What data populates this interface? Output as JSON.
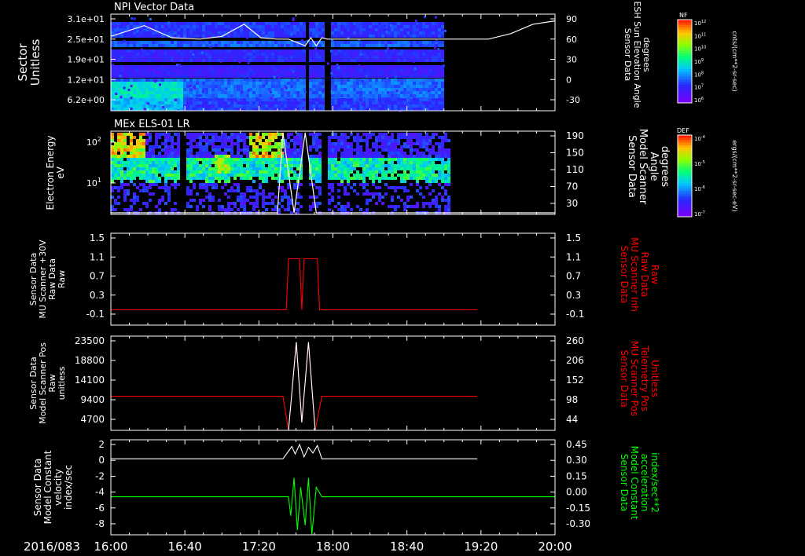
{
  "date_label": "2016/083",
  "time_ticks": [
    "16:00",
    "16:40",
    "17:20",
    "18:00",
    "18:40",
    "19:20",
    "20:00"
  ],
  "colors": {
    "background": "#000000",
    "axis": "#ffffff",
    "red_trace": "#ff0000",
    "green_trace": "#00ff00",
    "white_trace": "#ffffff"
  },
  "chart_data": [
    {
      "type": "heatmap",
      "title": "NPI Vector Data",
      "ylabel_left": [
        "Sector",
        "Unitless"
      ],
      "left_ticks": [
        "3.1e+01",
        "2.5e+01",
        "1.9e+01",
        "1.2e+01",
        "6.2e+00"
      ],
      "ylabel_right": [
        "Sensor Data",
        "ESH Sun Elevation Angle",
        "degrees"
      ],
      "right_ticks": [
        "90",
        "60",
        "30",
        "0",
        "-30"
      ],
      "colorbar": {
        "label": "NF",
        "units": "cnts/(cm**2-sr-sec)",
        "ticks": [
          "10^12",
          "10^11",
          "10^10",
          "10^9",
          "10^8",
          "10^7",
          "10^6"
        ]
      },
      "overlay_line": {
        "x": [
          16.0,
          16.3,
          16.55,
          16.8,
          17.0,
          17.2,
          17.35,
          17.5,
          17.6,
          17.75,
          17.8,
          17.85,
          17.9,
          17.95,
          19.4,
          19.6,
          19.8,
          20.0
        ],
        "y": [
          64,
          80,
          62,
          60,
          64,
          82,
          62,
          60,
          60,
          50,
          62,
          50,
          62,
          60,
          60,
          68,
          82,
          87
        ]
      }
    },
    {
      "type": "heatmap",
      "title": "MEx ELS-01 LR",
      "ylabel_left": [
        "Electron Energy",
        "eV"
      ],
      "left_ticks": [
        "10^2",
        "10^1"
      ],
      "ylabel_right": [
        "Sensor Data",
        "Model Scanner",
        "Angle",
        "degrees"
      ],
      "right_ticks": [
        "190",
        "150",
        "110",
        "70",
        "30"
      ],
      "colorbar": {
        "label": "DEF",
        "units": "ergs/(cm**2-sr-sec-eV)",
        "ticks": [
          "10^-4",
          "10^-5",
          "10^-6",
          "10^-7"
        ]
      },
      "overlay_line": {
        "x": [
          16.0,
          17.5,
          17.55,
          17.65,
          17.75,
          17.85,
          17.95,
          20.0
        ],
        "y": [
          0,
          0,
          190,
          0,
          190,
          0,
          0,
          0
        ]
      }
    },
    {
      "type": "line",
      "ylabel_left": [
        "Sensor Data",
        "MU Scanner +30V",
        "Raw Data",
        "Raw"
      ],
      "left_ticks": [
        "1.5",
        "1.1",
        "0.7",
        "0.3",
        "-0.1"
      ],
      "ylabel_right": [
        "Sensor Data",
        "MU Scanner Inh",
        "Raw Data",
        "Raw"
      ],
      "right_ticks": [
        "1.5",
        "1.1",
        "0.7",
        "0.3",
        "-0.1"
      ],
      "ylim": [
        -0.3,
        1.5
      ],
      "series": [
        {
          "color": "#ff0000",
          "x": [
            16.0,
            17.58,
            17.6,
            17.7,
            17.72,
            17.74,
            17.76,
            17.86,
            17.88,
            19.3
          ],
          "y": [
            -0.0,
            -0.0,
            1.0,
            1.0,
            0.0,
            1.0,
            1.0,
            1.0,
            -0.0,
            -0.0
          ]
        }
      ]
    },
    {
      "type": "line",
      "ylabel_left": [
        "Sensor Data",
        "Model Scanner Pos",
        "Raw",
        "unitless"
      ],
      "left_ticks": [
        "23500",
        "18800",
        "14100",
        "9400",
        "4700"
      ],
      "ylabel_right": [
        "Sensor Data",
        "MU Scanner Pos",
        "Telemetry Pos",
        "Unitless"
      ],
      "right_ticks": [
        "260",
        "206",
        "152",
        "98",
        "44"
      ],
      "ylim": [
        0,
        23500
      ],
      "series": [
        {
          "color": "#ff0000",
          "x": [
            16.0,
            17.55,
            17.6,
            17.67,
            17.72,
            17.78,
            17.84,
            17.9,
            19.3
          ],
          "y": [
            8500,
            8500,
            0,
            22000,
            2000,
            22000,
            0,
            8500,
            8500
          ]
        },
        {
          "color": "#ffffff",
          "x": [
            17.6,
            17.67,
            17.72,
            17.78,
            17.84
          ],
          "y": [
            0,
            22000,
            2000,
            22000,
            0
          ]
        }
      ]
    },
    {
      "type": "line",
      "ylabel_left": [
        "Sensor Data",
        "Model Constant",
        "velocity",
        "index/sec"
      ],
      "left_ticks": [
        "2",
        "0",
        "-2",
        "-4",
        "-6",
        "-8"
      ],
      "ylabel_right": [
        "Sensor Data",
        "Model Constant",
        "acceleration",
        "index/sec**2"
      ],
      "right_ticks": [
        "0.45",
        "0.30",
        "0.15",
        "0.00",
        "-0.15",
        "-0.30"
      ],
      "ylim": [
        -8,
        2
      ],
      "series": [
        {
          "color": "#ffffff",
          "x": [
            16.0,
            17.55,
            17.6,
            17.63,
            17.66,
            17.7,
            17.74,
            17.78,
            17.82,
            17.86,
            17.9,
            19.3
          ],
          "y": [
            0,
            0,
            0.8,
            1.3,
            0.5,
            1.5,
            0.2,
            1.2,
            0.6,
            1.4,
            0,
            0
          ]
        },
        {
          "color": "#00ff00",
          "x": [
            16.0,
            17.6,
            17.62,
            17.65,
            17.68,
            17.71,
            17.75,
            17.78,
            17.81,
            17.85,
            17.9,
            20.0
          ],
          "y": [
            -4,
            -4,
            -6,
            -2,
            -7.5,
            -3,
            -7,
            -2,
            -8,
            -3,
            -4,
            -4
          ]
        }
      ]
    }
  ]
}
